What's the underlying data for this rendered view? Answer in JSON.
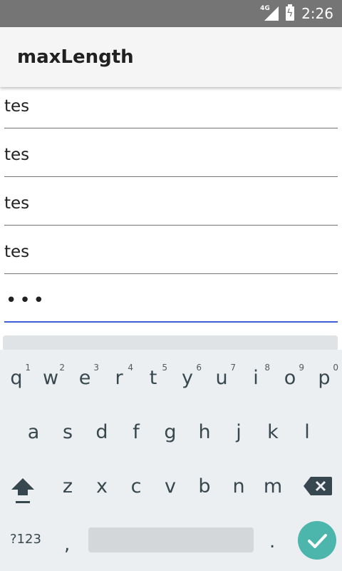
{
  "status": {
    "network": "4G",
    "time": "2:26"
  },
  "app": {
    "title": "maxLength"
  },
  "fields": [
    {
      "value": "tes"
    },
    {
      "value": "tes"
    },
    {
      "value": "tes"
    },
    {
      "value": "tes"
    },
    {
      "value": "•••",
      "type": "password"
    }
  ],
  "keyboard": {
    "row1": [
      {
        "ch": "q",
        "hint": "1"
      },
      {
        "ch": "w",
        "hint": "2"
      },
      {
        "ch": "e",
        "hint": "3"
      },
      {
        "ch": "r",
        "hint": "4"
      },
      {
        "ch": "t",
        "hint": "5"
      },
      {
        "ch": "y",
        "hint": "6"
      },
      {
        "ch": "u",
        "hint": "7"
      },
      {
        "ch": "i",
        "hint": "8"
      },
      {
        "ch": "o",
        "hint": "9"
      },
      {
        "ch": "p",
        "hint": "0"
      }
    ],
    "row2": [
      "a",
      "s",
      "d",
      "f",
      "g",
      "h",
      "j",
      "k",
      "l"
    ],
    "row3": [
      "z",
      "x",
      "c",
      "v",
      "b",
      "n",
      "m"
    ],
    "symbols_label": "?123",
    "comma": ",",
    "period": "."
  },
  "colors": {
    "accent": "#3f5fd8",
    "enter": "#4db6ac"
  }
}
